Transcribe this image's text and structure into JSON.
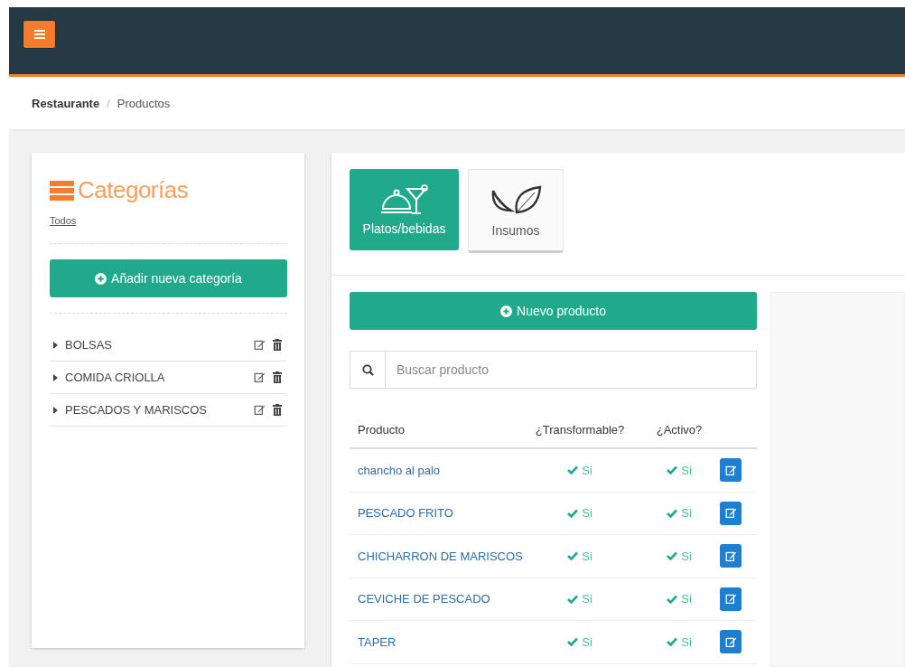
{
  "breadcrumb_separator": "/",
  "breadcrumb": [
    {
      "label": "Restaurante",
      "current": false
    },
    {
      "label": "Productos",
      "current": true
    }
  ],
  "categories": {
    "title": "Categorías",
    "all_link": "Todos",
    "add_button": "Añadir nueva categoría",
    "items": [
      {
        "name": "BOLSAS",
        "expanded": false
      },
      {
        "name": "COMIDA CRIOLLA",
        "expanded": false
      },
      {
        "name": "PESCADOS Y MARISCOS",
        "expanded": false
      }
    ]
  },
  "tabs": [
    {
      "label": "Platos/bebidas",
      "kind": "dishes",
      "selected": true
    },
    {
      "label": "Insumos",
      "kind": "supplies",
      "selected": false
    }
  ],
  "new_button": "Nuevo producto",
  "search": {
    "placeholder": "Buscar producto"
  },
  "table": {
    "columns": [
      "Producto",
      "¿Transformable?",
      "¿Activo?"
    ],
    "rows": [
      {
        "name": "chancho al palo",
        "transformable": true,
        "transformable_text": "Si",
        "active": true,
        "active_text": "Si"
      },
      {
        "name": "PESCADO FRITO",
        "transformable": true,
        "transformable_text": "Si",
        "active": true,
        "active_text": "Si"
      },
      {
        "name": "CHICHARRON DE MARISCOS",
        "transformable": true,
        "transformable_text": "Si",
        "active": true,
        "active_text": "Si"
      },
      {
        "name": "CEVICHE DE PESCADO",
        "transformable": true,
        "transformable_text": "Si",
        "active": true,
        "active_text": "Si"
      },
      {
        "name": "TAPER",
        "transformable": true,
        "transformable_text": "Si",
        "active": true,
        "active_text": "Si"
      }
    ]
  }
}
